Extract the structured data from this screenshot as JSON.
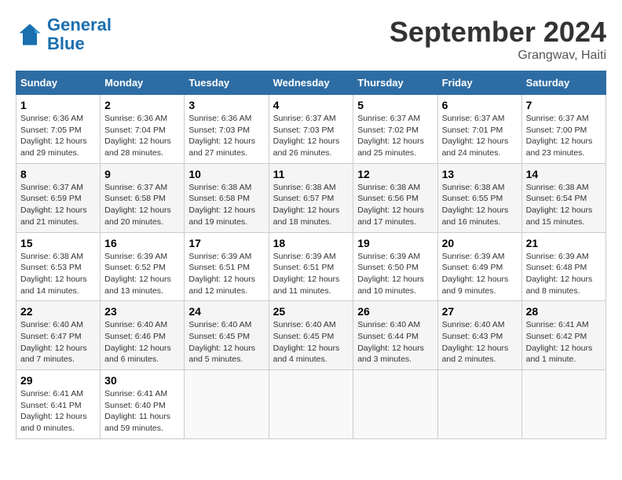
{
  "header": {
    "logo_line1": "General",
    "logo_line2": "Blue",
    "month": "September 2024",
    "location": "Grangwav, Haiti"
  },
  "columns": [
    "Sunday",
    "Monday",
    "Tuesday",
    "Wednesday",
    "Thursday",
    "Friday",
    "Saturday"
  ],
  "weeks": [
    [
      {
        "day": "1",
        "sunrise": "6:36 AM",
        "sunset": "7:05 PM",
        "daylight": "12 hours and 29 minutes."
      },
      {
        "day": "2",
        "sunrise": "6:36 AM",
        "sunset": "7:04 PM",
        "daylight": "12 hours and 28 minutes."
      },
      {
        "day": "3",
        "sunrise": "6:36 AM",
        "sunset": "7:03 PM",
        "daylight": "12 hours and 27 minutes."
      },
      {
        "day": "4",
        "sunrise": "6:37 AM",
        "sunset": "7:03 PM",
        "daylight": "12 hours and 26 minutes."
      },
      {
        "day": "5",
        "sunrise": "6:37 AM",
        "sunset": "7:02 PM",
        "daylight": "12 hours and 25 minutes."
      },
      {
        "day": "6",
        "sunrise": "6:37 AM",
        "sunset": "7:01 PM",
        "daylight": "12 hours and 24 minutes."
      },
      {
        "day": "7",
        "sunrise": "6:37 AM",
        "sunset": "7:00 PM",
        "daylight": "12 hours and 23 minutes."
      }
    ],
    [
      {
        "day": "8",
        "sunrise": "6:37 AM",
        "sunset": "6:59 PM",
        "daylight": "12 hours and 21 minutes."
      },
      {
        "day": "9",
        "sunrise": "6:37 AM",
        "sunset": "6:58 PM",
        "daylight": "12 hours and 20 minutes."
      },
      {
        "day": "10",
        "sunrise": "6:38 AM",
        "sunset": "6:58 PM",
        "daylight": "12 hours and 19 minutes."
      },
      {
        "day": "11",
        "sunrise": "6:38 AM",
        "sunset": "6:57 PM",
        "daylight": "12 hours and 18 minutes."
      },
      {
        "day": "12",
        "sunrise": "6:38 AM",
        "sunset": "6:56 PM",
        "daylight": "12 hours and 17 minutes."
      },
      {
        "day": "13",
        "sunrise": "6:38 AM",
        "sunset": "6:55 PM",
        "daylight": "12 hours and 16 minutes."
      },
      {
        "day": "14",
        "sunrise": "6:38 AM",
        "sunset": "6:54 PM",
        "daylight": "12 hours and 15 minutes."
      }
    ],
    [
      {
        "day": "15",
        "sunrise": "6:38 AM",
        "sunset": "6:53 PM",
        "daylight": "12 hours and 14 minutes."
      },
      {
        "day": "16",
        "sunrise": "6:39 AM",
        "sunset": "6:52 PM",
        "daylight": "12 hours and 13 minutes."
      },
      {
        "day": "17",
        "sunrise": "6:39 AM",
        "sunset": "6:51 PM",
        "daylight": "12 hours and 12 minutes."
      },
      {
        "day": "18",
        "sunrise": "6:39 AM",
        "sunset": "6:51 PM",
        "daylight": "12 hours and 11 minutes."
      },
      {
        "day": "19",
        "sunrise": "6:39 AM",
        "sunset": "6:50 PM",
        "daylight": "12 hours and 10 minutes."
      },
      {
        "day": "20",
        "sunrise": "6:39 AM",
        "sunset": "6:49 PM",
        "daylight": "12 hours and 9 minutes."
      },
      {
        "day": "21",
        "sunrise": "6:39 AM",
        "sunset": "6:48 PM",
        "daylight": "12 hours and 8 minutes."
      }
    ],
    [
      {
        "day": "22",
        "sunrise": "6:40 AM",
        "sunset": "6:47 PM",
        "daylight": "12 hours and 7 minutes."
      },
      {
        "day": "23",
        "sunrise": "6:40 AM",
        "sunset": "6:46 PM",
        "daylight": "12 hours and 6 minutes."
      },
      {
        "day": "24",
        "sunrise": "6:40 AM",
        "sunset": "6:45 PM",
        "daylight": "12 hours and 5 minutes."
      },
      {
        "day": "25",
        "sunrise": "6:40 AM",
        "sunset": "6:45 PM",
        "daylight": "12 hours and 4 minutes."
      },
      {
        "day": "26",
        "sunrise": "6:40 AM",
        "sunset": "6:44 PM",
        "daylight": "12 hours and 3 minutes."
      },
      {
        "day": "27",
        "sunrise": "6:40 AM",
        "sunset": "6:43 PM",
        "daylight": "12 hours and 2 minutes."
      },
      {
        "day": "28",
        "sunrise": "6:41 AM",
        "sunset": "6:42 PM",
        "daylight": "12 hours and 1 minute."
      }
    ],
    [
      {
        "day": "29",
        "sunrise": "6:41 AM",
        "sunset": "6:41 PM",
        "daylight": "12 hours and 0 minutes."
      },
      {
        "day": "30",
        "sunrise": "6:41 AM",
        "sunset": "6:40 PM",
        "daylight": "11 hours and 59 minutes."
      },
      null,
      null,
      null,
      null,
      null
    ]
  ]
}
